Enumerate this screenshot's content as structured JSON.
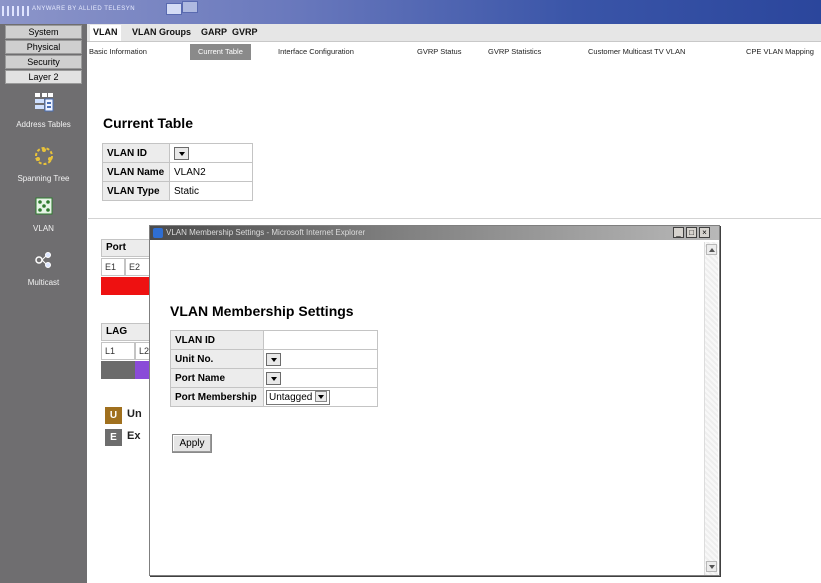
{
  "banner": {
    "brand_text": "ANYWARE BY ALLIED TELESYN",
    "stripes_icon": "stripes-logo-icon",
    "logo_icon": "product-logo-icon"
  },
  "leftnav": {
    "tabs": [
      {
        "label": "System"
      },
      {
        "label": "Physical"
      },
      {
        "label": "Security"
      },
      {
        "label": "Layer 2"
      }
    ],
    "icons": [
      {
        "label": "Address Tables",
        "icon": "address-tables-icon"
      },
      {
        "label": "Spanning Tree",
        "icon": "spanning-tree-icon"
      },
      {
        "label": "VLAN",
        "icon": "vlan-icon"
      },
      {
        "label": "Multicast",
        "icon": "multicast-icon"
      }
    ]
  },
  "tabs_top": [
    {
      "label": "VLAN",
      "active": true
    },
    {
      "label": "VLAN Groups"
    },
    {
      "label": "GARP"
    },
    {
      "label": "GVRP"
    }
  ],
  "tabs_sub": [
    {
      "label": "Basic Information"
    },
    {
      "label": "Current Table",
      "active": true
    },
    {
      "label": "Interface Configuration"
    },
    {
      "label": "GVRP Status"
    },
    {
      "label": "GVRP Statistics"
    },
    {
      "label": "Customer Multicast TV VLAN"
    },
    {
      "label": "CPE VLAN Mapping"
    }
  ],
  "main": {
    "title": "Current Table",
    "vlan_id_label": "VLAN ID",
    "vlan_id_value": "",
    "vlan_name_label": "VLAN Name",
    "vlan_name_value": "VLAN2",
    "vlan_type_label": "VLAN Type",
    "vlan_type_value": "Static",
    "port_header": "Port",
    "port_cols": [
      "E1",
      "E2"
    ],
    "lag_header": "LAG",
    "lag_cols": [
      "L1",
      "L2"
    ],
    "legend": [
      {
        "code": "U",
        "text": "Un",
        "color": "#a0701e"
      },
      {
        "code": "E",
        "text": "Ex",
        "color": "#6d6d6d"
      }
    ],
    "colors": {
      "port_red": "#ee1111",
      "lag_gray": "#6b6b6b",
      "lag_purple": "#8a4cd8"
    }
  },
  "popup": {
    "title": "VLAN Membership Settings - Microsoft Internet Explorer",
    "heading": "VLAN Membership Settings",
    "window_buttons": [
      {
        "label": "_",
        "icon": "minimize-icon"
      },
      {
        "label": "□",
        "icon": "maximize-icon"
      },
      {
        "label": "×",
        "icon": "close-icon"
      }
    ],
    "fields": {
      "vlan_id_label": "VLAN ID",
      "vlan_id_value": "",
      "unit_no_label": "Unit No.",
      "port_name_label": "Port Name",
      "port_membership_label": "Port Membership",
      "port_membership_value": "Untagged"
    },
    "apply_label": "Apply"
  }
}
